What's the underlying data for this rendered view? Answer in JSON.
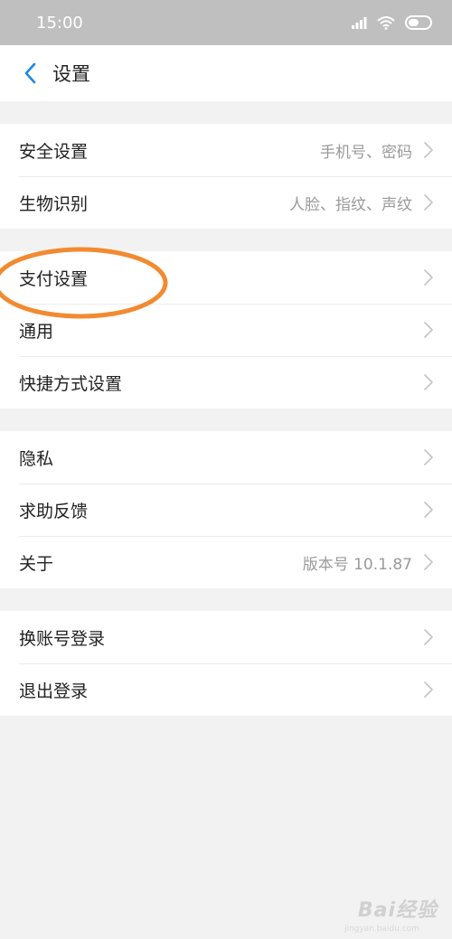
{
  "status_bar": {
    "time": "15:00",
    "icons": [
      "signal-icon",
      "wifi-icon",
      "battery-icon"
    ]
  },
  "nav": {
    "title": "设置",
    "back_icon": "chevron-left-icon",
    "accent": "#1e88e5"
  },
  "groups": [
    {
      "rows": [
        {
          "label": "安全设置",
          "value": "手机号、密码"
        },
        {
          "label": "生物识别",
          "value": "人脸、指纹、声纹"
        }
      ]
    },
    {
      "rows": [
        {
          "label": "支付设置",
          "value": ""
        },
        {
          "label": "通用",
          "value": ""
        },
        {
          "label": "快捷方式设置",
          "value": ""
        }
      ]
    },
    {
      "rows": [
        {
          "label": "隐私",
          "value": ""
        },
        {
          "label": "求助反馈",
          "value": ""
        },
        {
          "label": "关于",
          "value": "版本号 10.1.87"
        }
      ]
    },
    {
      "rows": [
        {
          "label": "换账号登录",
          "value": ""
        },
        {
          "label": "退出登录",
          "value": ""
        }
      ]
    }
  ],
  "annotation": {
    "color": "#f28a30",
    "target": "支付设置"
  },
  "watermark": {
    "text": "Bai经验",
    "sub": "jingyan.baidu.com"
  }
}
